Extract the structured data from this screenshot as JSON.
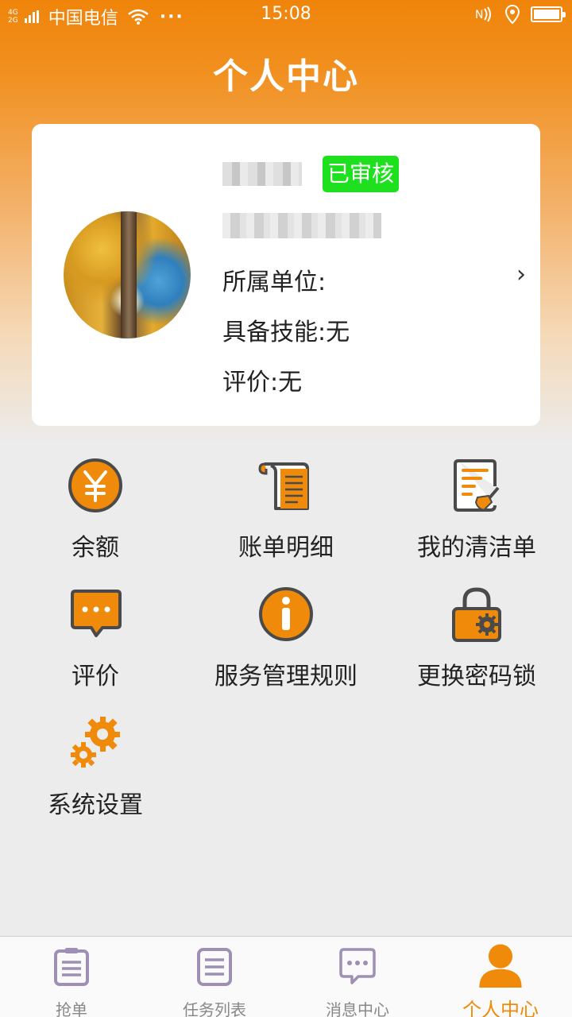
{
  "status_bar": {
    "network_top": "4G",
    "network_bottom": "2G",
    "carrier": "中国电信",
    "more": "···",
    "time": "15:08"
  },
  "header": {
    "title": "个人中心"
  },
  "profile": {
    "verified_badge": "已审核",
    "unit": "所属单位:",
    "skills": "具备技能:无",
    "rating": "评价:无",
    "chevron": "›"
  },
  "menu": [
    {
      "label": "余额",
      "icon": "yuan-coin-icon"
    },
    {
      "label": "账单明细",
      "icon": "bill-scroll-icon"
    },
    {
      "label": "我的清洁单",
      "icon": "cleaning-list-icon"
    },
    {
      "label": "评价",
      "icon": "chat-bubble-icon"
    },
    {
      "label": "服务管理规则",
      "icon": "info-icon"
    },
    {
      "label": "更换密码锁",
      "icon": "padlock-gear-icon"
    },
    {
      "label": "系统设置",
      "icon": "gears-icon"
    }
  ],
  "tabs": [
    {
      "label": "抢单",
      "icon": "clipboard-icon"
    },
    {
      "label": "任务列表",
      "icon": "task-list-icon"
    },
    {
      "label": "消息中心",
      "icon": "message-icon"
    },
    {
      "label": "个人中心",
      "icon": "person-icon",
      "active": true
    }
  ],
  "colors": {
    "accent": "#f08a0a",
    "badge": "#1fe01f",
    "icon_dark": "#4a4a4a",
    "tab_inactive": "#9e8fb4"
  }
}
